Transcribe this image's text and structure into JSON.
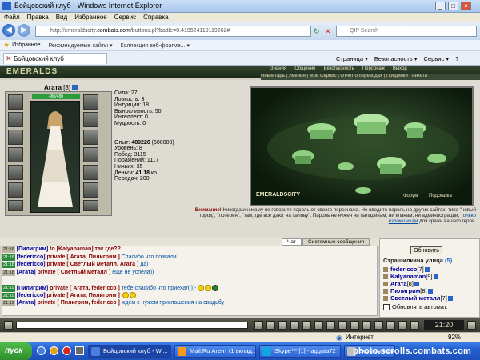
{
  "window": {
    "title": "Бойцовский клуб - Windows Internet Explorer",
    "buttons": [
      "_",
      "□",
      "×"
    ]
  },
  "menu": {
    "items": [
      "Файл",
      "Правка",
      "Вид",
      "Избранное",
      "Сервис",
      "Справка"
    ]
  },
  "address": {
    "url_prefix": "http://emeraldscity.",
    "url_domain": "combats.com",
    "url_rest": "/buttons.pl?battle=0.419524119119262#",
    "search_placeholder": "QIP Search"
  },
  "favorites": {
    "label": "Избранное",
    "items": [
      "Рекомендуемые сайты ▾",
      "Коллекция веб-фрагме... ▾"
    ]
  },
  "tab": {
    "title": "Бойцовский клуб",
    "tools": [
      "Страница ▾",
      "Безопасность ▾",
      "Сервис ▾",
      "?"
    ]
  },
  "game": {
    "logo": "EMERALDS",
    "nav": [
      "Знания",
      "Общение",
      "Безопасность",
      "Персонаж",
      "Выход"
    ],
    "nav2": "Инвентарь | Умения | Мой Сервис | Отчет о переводах | Поединки | Анкета",
    "character": {
      "name": "Агата",
      "level": "[8]",
      "hp": "480/480"
    },
    "stats": [
      {
        "label": "Сила: ",
        "value": "27"
      },
      {
        "label": "Ловкость: ",
        "value": "3"
      },
      {
        "label": "Интуиция: ",
        "value": "18"
      },
      {
        "label": "Выносливость: ",
        "value": "50"
      },
      {
        "label": "Интеллект: ",
        "value": "0"
      },
      {
        "label": "Мудрость: ",
        "value": "0"
      }
    ],
    "exp": {
      "label": "Опыт: ",
      "value": "489226",
      "next": " (500000)"
    },
    "stats2": [
      {
        "label": "Уровень: ",
        "value": "8"
      },
      {
        "label": "Побед: ",
        "value": "3115"
      },
      {
        "label": "Поражений: ",
        "value": "1117"
      },
      {
        "label": "Ничьих: ",
        "value": "35"
      }
    ],
    "money": {
      "label": "Деньги: ",
      "value": "41.18",
      "unit": " кр."
    },
    "transfers": {
      "label": "Передач: ",
      "value": "200"
    },
    "scene": {
      "caption": "EMERALDSCITY",
      "links": [
        "Форум",
        "Подсказка"
      ]
    },
    "notice": {
      "label": "Внимание!",
      "text": " Никогда и никому не говорите пароль от своего персонажа. Не вводите пароль на других сайтах, типа \"новый город\", \"лотерея\", \"там, где все дают на халяву\". Пароль не нужен ни паладинам, ни кланам, ни администрации,",
      "link": "только взломщикам",
      "tail": " для кражи вашего героя."
    }
  },
  "chat": {
    "tabs": [
      "Чат",
      "Системные сообщения"
    ],
    "lines": [
      {
        "time": "21:16",
        "time_style": "r",
        "parts": [
          [
            "nm",
            "[Пилигрим] "
          ],
          [
            "pv",
            "to [Kalyanaman] так где??"
          ]
        ]
      },
      {
        "time": "21:16",
        "time_style": "g",
        "parts": [
          [
            "nm",
            "[federicco] "
          ],
          [
            "pv",
            "private [ Агата, Пилигрим ] "
          ],
          [
            "msg",
            "Спасибо что позвали"
          ]
        ]
      },
      {
        "time": "21:18",
        "time_style": "g",
        "parts": [
          [
            "nm",
            "[federicco] "
          ],
          [
            "pv",
            "private [ Светлый металл, Агата ] "
          ],
          [
            "msg",
            "да)"
          ]
        ]
      },
      {
        "time": "21:18",
        "time_style": "r",
        "parts": [
          [
            "nm",
            "[Агата] "
          ],
          [
            "pv",
            "private [ Светлый металл ] "
          ],
          [
            "msg",
            "еще не успела))"
          ]
        ]
      },
      {
        "time": "",
        "time_style": "r",
        "parts": []
      },
      {
        "time": "21:19",
        "time_style": "g",
        "parts": [
          [
            "nm",
            "[Пилигрим] "
          ],
          [
            "pv",
            "private [ Агата, federicco ] "
          ],
          [
            "msg",
            "тебе спасибо что приехал)))-"
          ]
        ],
        "icons": [
          "smile",
          "smile",
          "hat"
        ]
      },
      {
        "time": "21:19",
        "time_style": "g",
        "parts": [
          [
            "nm",
            "[federicco] "
          ],
          [
            "pv",
            "private [ Агата, Пилигрим ] "
          ]
        ],
        "icons": [
          "smile",
          "smile"
        ]
      },
      {
        "time": "21:19",
        "time_style": "r",
        "parts": [
          [
            "nm",
            "[Агата] "
          ],
          [
            "pv",
            "private [ Пилигрим, federicco ] "
          ],
          [
            "msg",
            "ждем с нужем приглашения на свадьбу"
          ]
        ]
      },
      {
        "time": "",
        "time_style": "r",
        "parts": []
      },
      {
        "time": "21:19",
        "time_style": "g",
        "parts": [
          [
            "nm",
            "[Пилигрим] "
          ],
          [
            "pv",
            "private [ Агата, federicco ] "
          ],
          [
            "msg",
            "Удачки на просторах ВКа и в Реале!!"
          ]
        ],
        "icons": [
          "smile",
          "smile",
          "hat"
        ]
      },
      {
        "time": "21:20",
        "time_style": "g",
        "parts": [
          [
            "nm",
            "[Агата] "
          ],
          [
            "pv",
            "private [ Пилигрим, federicco, Светлый металл ] "
          ],
          [
            "msg",
            "ждем с нужем приглашения на свадьбу"
          ]
        ]
      },
      {
        "time": "21:20",
        "time_style": "r",
        "parts": [
          [
            "nm",
            "[federicco] "
          ],
          [
            "pv",
            "private [ Светлый металл, Пилигрим, Агата ] "
          ],
          [
            "msg",
            "обязательно)"
          ]
        ]
      }
    ]
  },
  "side": {
    "refresh": "Обновить",
    "street": "Страшилкина улица",
    "count": "(5)",
    "users": [
      {
        "name": "federicco",
        "lvl": "[7]"
      },
      {
        "name": "Kalyanaman",
        "lvl": "[9]"
      },
      {
        "name": "Агата",
        "lvl": "[8]"
      },
      {
        "name": "Пилигрим",
        "lvl": "[8]"
      },
      {
        "name": "Светлый металл",
        "lvl": "[7]"
      }
    ],
    "auto": "Обновлять автомат."
  },
  "clock": "21:20",
  "status": {
    "zone": "Интернет",
    "zoom": "92%"
  },
  "taskbar": {
    "start": "пуск",
    "tasks": [
      "Бойцовский клуб - Wi...",
      "Mail.Ru Агент (1 вклад...",
      "Skype™ [1] - aggata72",
      "Безымянный..."
    ],
    "watermark": "photo.scrolls.combats.com"
  }
}
